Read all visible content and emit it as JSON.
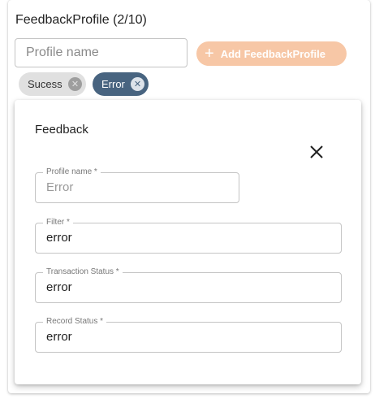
{
  "header": {
    "title": "FeedbackProfile (2/10)"
  },
  "profile_input": {
    "placeholder": "Profile name",
    "value": ""
  },
  "add_button": {
    "icon": "plus-icon",
    "label": "Add FeedbackProfile",
    "color": "#f7c7a6"
  },
  "chips": [
    {
      "label": "Sucess",
      "selected": false,
      "color": "#e0e0e0"
    },
    {
      "label": "Error",
      "selected": true,
      "color": "#486480"
    }
  ],
  "feedback_card": {
    "title": "Feedback",
    "close_icon": "close-icon",
    "fields": [
      {
        "label": "Profile name *",
        "value": "Error",
        "disabled": true
      },
      {
        "label": "Filter *",
        "value": "error"
      },
      {
        "label": "Transaction Status *",
        "value": "error"
      },
      {
        "label": "Record Status *",
        "value": "error"
      }
    ]
  }
}
